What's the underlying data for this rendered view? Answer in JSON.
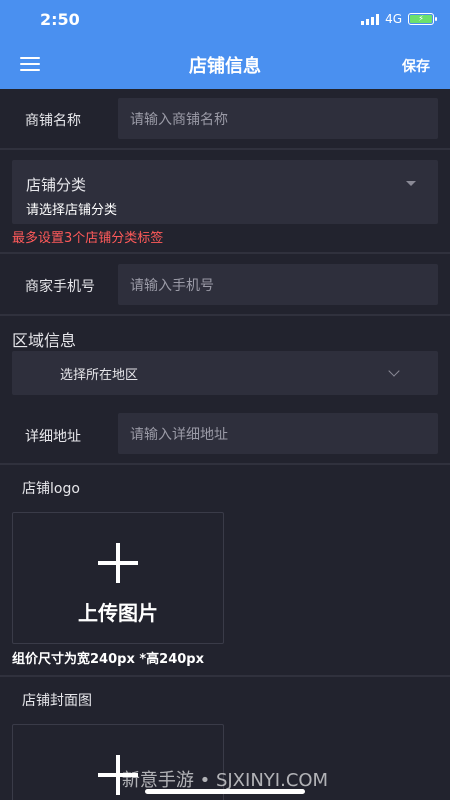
{
  "status_bar": {
    "time": "2:50",
    "network": "4G"
  },
  "header": {
    "title": "店铺信息",
    "save_label": "保存"
  },
  "form": {
    "shop_name": {
      "label": "商铺名称",
      "placeholder": "请输入商铺名称"
    },
    "category": {
      "label": "店铺分类",
      "placeholder": "请选择店铺分类",
      "warning": "最多设置3个店铺分类标签"
    },
    "phone": {
      "label": "商家手机号",
      "placeholder": "请输入手机号"
    },
    "region": {
      "section_title": "区域信息",
      "select_text": "选择所在地区"
    },
    "address": {
      "label": "详细地址",
      "placeholder": "请输入详细地址"
    },
    "logo": {
      "label": "店铺logo",
      "upload_label": "上传图片",
      "size_hint": "组价尺寸为宽240px *高240px"
    },
    "cover": {
      "label": "店铺封面图"
    }
  },
  "watermark": "新意手游 • SJXINYI.COM",
  "colors": {
    "header": "#4a90f0",
    "background": "#22232e",
    "input": "#2e2f3c",
    "warning": "#ff5a5a"
  }
}
